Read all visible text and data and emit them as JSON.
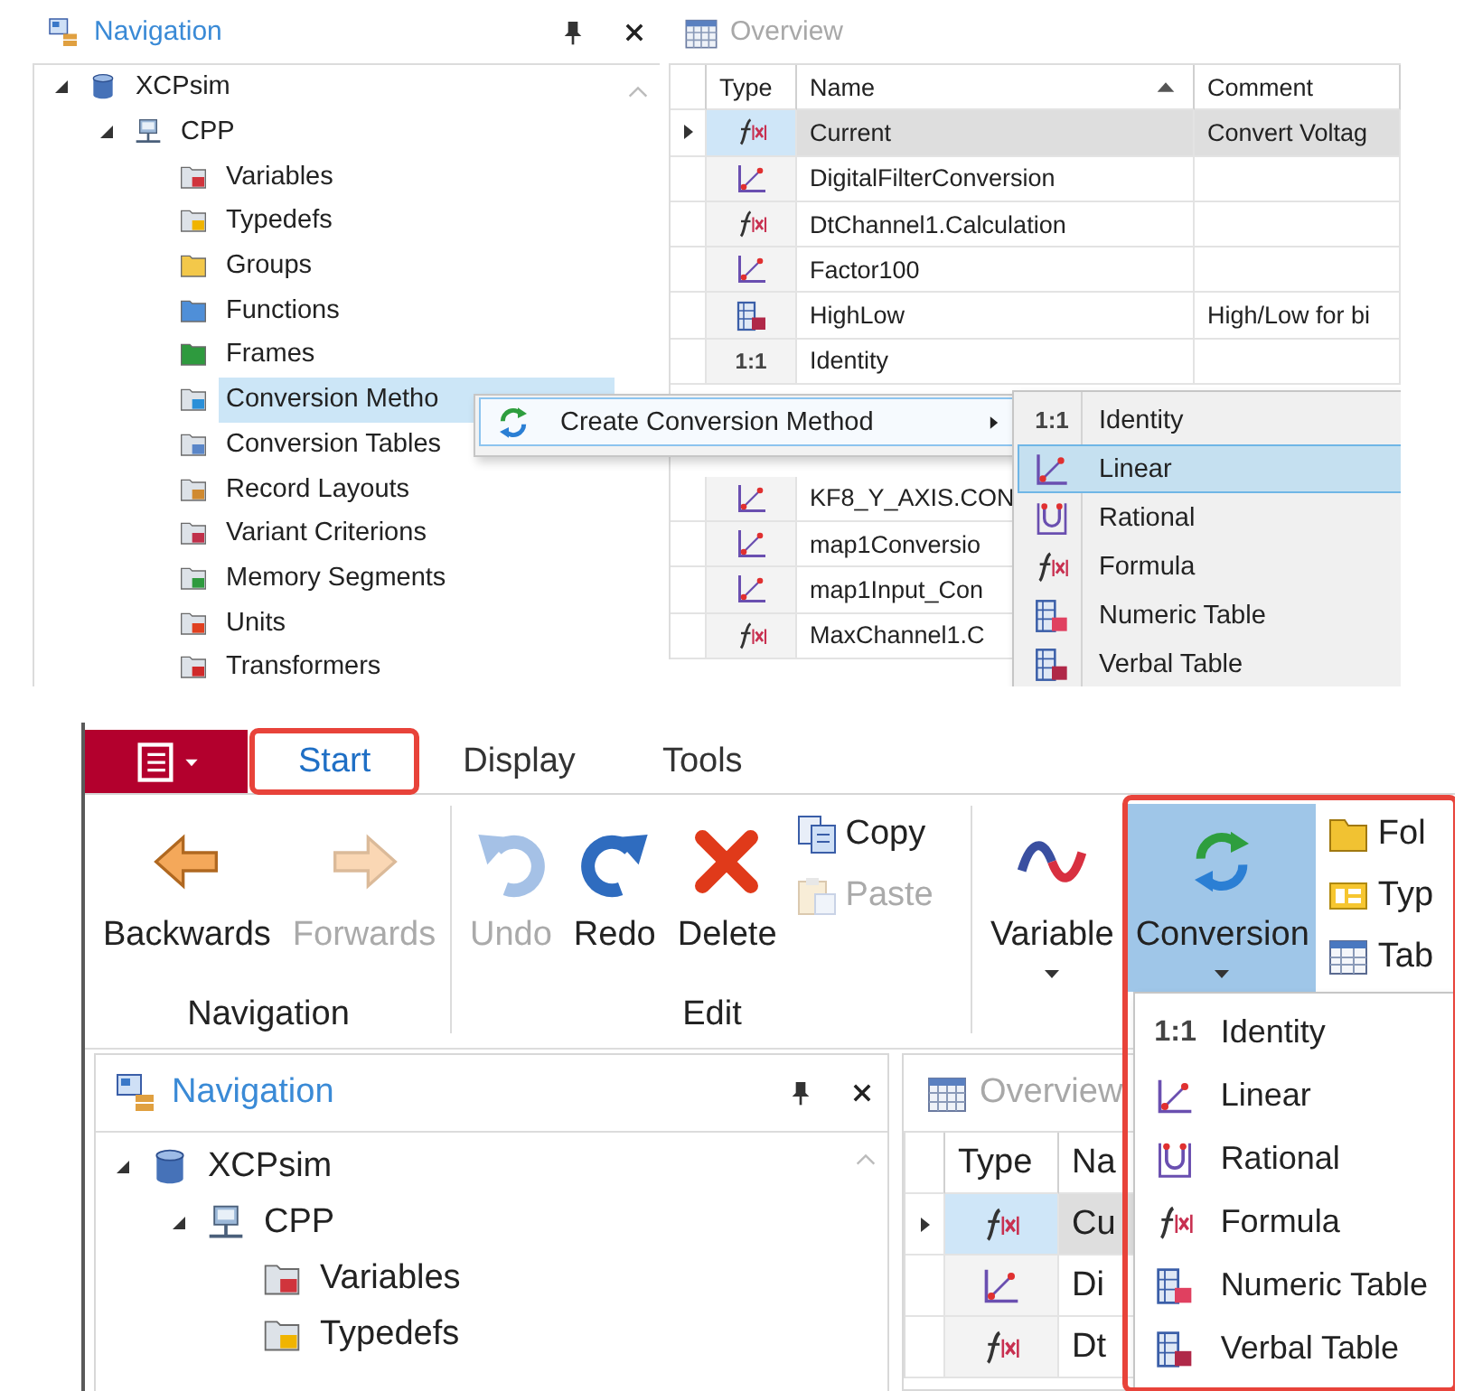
{
  "top_screenshot": {
    "navigation_pane": {
      "title": "Navigation",
      "tree": [
        {
          "label": "XCPsim",
          "kind": "database",
          "expanded": true,
          "selected": false,
          "children": [
            {
              "label": "CPP",
              "kind": "computer",
              "expanded": true,
              "selected": false,
              "children": [
                {
                  "label": "Variables",
                  "kind": "variables",
                  "selected": false
                },
                {
                  "label": "Typedefs",
                  "kind": "typedefs",
                  "selected": false
                },
                {
                  "label": "Groups",
                  "kind": "groups",
                  "selected": false
                },
                {
                  "label": "Functions",
                  "kind": "functions",
                  "selected": false
                },
                {
                  "label": "Frames",
                  "kind": "frames",
                  "selected": false
                },
                {
                  "label": "Conversion Metho",
                  "kind": "conversions",
                  "selected": true
                },
                {
                  "label": "Conversion Tables",
                  "kind": "tables",
                  "selected": false
                },
                {
                  "label": "Record Layouts",
                  "kind": "records",
                  "selected": false
                },
                {
                  "label": "Variant Criterions",
                  "kind": "variants",
                  "selected": false
                },
                {
                  "label": "Memory Segments",
                  "kind": "memory",
                  "selected": false
                },
                {
                  "label": "Units",
                  "kind": "units",
                  "selected": false
                },
                {
                  "label": "Transformers",
                  "kind": "transformers",
                  "selected": false
                }
              ]
            }
          ]
        }
      ]
    },
    "overview_pane": {
      "title": "Overview",
      "columns": [
        {
          "label": "Type",
          "sorted": false
        },
        {
          "label": "Name",
          "sorted": true
        },
        {
          "label": "Comment",
          "sorted": false
        }
      ],
      "rows": [
        {
          "kind": "formula",
          "name": "Current",
          "comment": "Convert Voltag",
          "selected": true
        },
        {
          "kind": "linear",
          "name": "DigitalFilterConversion",
          "selected": false
        },
        {
          "kind": "formula",
          "name": "DtChannel1.Calculation",
          "selected": false
        },
        {
          "kind": "linear",
          "name": "Factor100",
          "selected": false
        },
        {
          "kind": "verbal",
          "name": "HighLow",
          "comment": "High/Low for bi",
          "selected": false
        },
        {
          "kind": "identity",
          "icon_text": "1:1",
          "name": "Identity",
          "selected": false
        },
        {
          "kind": "linear",
          "name": "KF8_Y_AXIS.CON",
          "selected": false
        },
        {
          "kind": "linear",
          "name": "map1Conversio",
          "selected": false
        },
        {
          "kind": "linear",
          "name": "map1Input_Con",
          "selected": false
        },
        {
          "kind": "formula",
          "name": "MaxChannel1.C",
          "selected": false
        }
      ]
    },
    "context_menu": {
      "items": [
        {
          "kind": "conversion",
          "label": "Create Conversion Method",
          "submenu": true,
          "selected": true
        }
      ]
    },
    "submenu": {
      "items": [
        {
          "kind": "identity",
          "icon_text": "1:1",
          "label": "Identity",
          "selected": false
        },
        {
          "kind": "linear",
          "label": "Linear",
          "selected": true
        },
        {
          "kind": "rational",
          "label": "Rational",
          "selected": false
        },
        {
          "kind": "formula",
          "label": "Formula",
          "selected": false
        },
        {
          "kind": "numeric",
          "label": "Numeric Table",
          "selected": false
        },
        {
          "kind": "verbal",
          "label": "Verbal Table",
          "selected": false
        }
      ]
    }
  },
  "bottom_screenshot": {
    "ribbon": {
      "tabs": [
        {
          "label": "Start",
          "selected": true,
          "highlighted": true
        },
        {
          "label": "Display",
          "selected": false,
          "highlighted": false
        },
        {
          "label": "Tools",
          "selected": false,
          "highlighted": false
        }
      ],
      "groups": [
        {
          "label": "Navigation",
          "items": [
            {
              "label": "Backwards",
              "kind": "back",
              "disabled": false,
              "pressed": false,
              "dropdown": false
            },
            {
              "label": "Forwards",
              "kind": "forward",
              "disabled": true,
              "pressed": false,
              "dropdown": false
            }
          ]
        },
        {
          "label": "Edit",
          "items": [
            {
              "label": "Undo",
              "kind": "undo",
              "disabled": true,
              "pressed": false,
              "dropdown": false
            },
            {
              "label": "Redo",
              "kind": "redo",
              "disabled": false,
              "pressed": false,
              "dropdown": false
            },
            {
              "label": "Delete",
              "kind": "delete",
              "disabled": false,
              "pressed": false,
              "dropdown": false
            }
          ],
          "small_items": [
            {
              "label": "Copy",
              "kind": "copy",
              "disabled": false
            },
            {
              "label": "Paste",
              "kind": "paste",
              "disabled": true
            }
          ]
        },
        {
          "items": [
            {
              "label": "Variable",
              "kind": "variable",
              "disabled": false,
              "pressed": false,
              "dropdown": true
            },
            {
              "label": "Conversion",
              "kind": "conversion",
              "disabled": false,
              "pressed": true,
              "dropdown": true
            }
          ],
          "small_items": [
            {
              "label": "Fol",
              "kind": "folder",
              "disabled": false
            },
            {
              "label": "Typ",
              "kind": "typedef",
              "disabled": false
            },
            {
              "label": "Tab",
              "kind": "table",
              "disabled": false
            }
          ]
        }
      ]
    },
    "conversion_menu": {
      "highlighted": true,
      "items": [
        {
          "kind": "identity",
          "icon_text": "1:1",
          "label": "Identity",
          "selected": false
        },
        {
          "kind": "linear",
          "label": "Linear",
          "selected": false
        },
        {
          "kind": "rational",
          "label": "Rational",
          "selected": false
        },
        {
          "kind": "formula",
          "label": "Formula",
          "selected": false
        },
        {
          "kind": "numeric",
          "label": "Numeric Table",
          "selected": false
        },
        {
          "kind": "verbal",
          "label": "Verbal Table",
          "selected": false
        }
      ]
    },
    "navigation_pane": {
      "title": "Navigation",
      "tree": [
        {
          "label": "XCPsim",
          "kind": "database",
          "expanded": true,
          "selected": false,
          "children": [
            {
              "label": "CPP",
              "kind": "computer",
              "expanded": true,
              "selected": false,
              "children": [
                {
                  "label": "Variables",
                  "kind": "variables",
                  "selected": false
                },
                {
                  "label": "Typedefs",
                  "kind": "typedefs",
                  "selected": false
                }
              ]
            }
          ]
        }
      ]
    },
    "overview_pane": {
      "title": "Overview",
      "columns": [
        {
          "label": "Type",
          "sorted": false
        },
        {
          "label": "Na",
          "sorted": false
        }
      ],
      "rows": [
        {
          "kind": "formula",
          "name": "Cu",
          "selected": true
        },
        {
          "kind": "linear",
          "name": "Di",
          "selected": false
        },
        {
          "kind": "formula",
          "name": "Dt",
          "selected": false
        }
      ]
    }
  }
}
